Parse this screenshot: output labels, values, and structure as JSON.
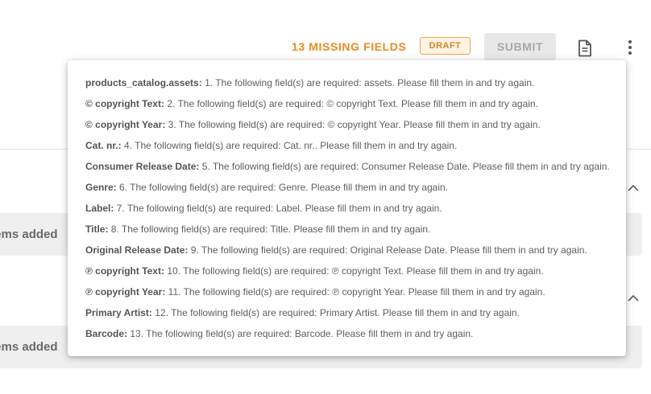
{
  "header": {
    "missing_fields_label": "13 MISSING FIELDS",
    "status_badge": "DRAFT",
    "submit_label": "SUBMIT",
    "doc_icon": "document-icon",
    "more_icon": "more-vertical-icon"
  },
  "sections": [
    {
      "label": "items added",
      "chevron": "chevron-up-icon"
    },
    {
      "label": "items added",
      "chevron": "chevron-up-icon"
    }
  ],
  "errors": [
    {
      "field": "products_catalog.assets:",
      "message": "1. The following field(s) are required: assets. Please fill them in and try again."
    },
    {
      "field": "© copyright Text:",
      "message": "2. The following field(s) are required: © copyright Text. Please fill them in and try again."
    },
    {
      "field": "© copyright Year:",
      "message": "3. The following field(s) are required: © copyright Year. Please fill them in and try again."
    },
    {
      "field": "Cat. nr.:",
      "message": "4. The following field(s) are required: Cat. nr.. Please fill them in and try again."
    },
    {
      "field": "Consumer Release Date:",
      "message": "5. The following field(s) are required: Consumer Release Date. Please fill them in and try again."
    },
    {
      "field": "Genre:",
      "message": "6. The following field(s) are required: Genre. Please fill them in and try again."
    },
    {
      "field": "Label:",
      "message": "7. The following field(s) are required: Label. Please fill them in and try again."
    },
    {
      "field": "Title:",
      "message": "8. The following field(s) are required: Title. Please fill them in and try again."
    },
    {
      "field": "Original Release Date:",
      "message": "9. The following field(s) are required: Original Release Date. Please fill them in and try again."
    },
    {
      "field": "℗ copyright Text:",
      "message": "10. The following field(s) are required: ℗ copyright Text. Please fill them in and try again."
    },
    {
      "field": "℗ copyright Year:",
      "message": "11. The following field(s) are required: ℗ copyright Year. Please fill them in and try again."
    },
    {
      "field": "Primary Artist:",
      "message": "12. The following field(s) are required: Primary Artist. Please fill them in and try again."
    },
    {
      "field": "Barcode:",
      "message": "13. The following field(s) are required: Barcode. Please fill them in and try again."
    }
  ],
  "colors": {
    "accent_orange": "#ec8a1c",
    "draft_border": "#e8a552",
    "draft_background": "#fff3e3",
    "submit_disabled_bg": "#e8e8e8",
    "submit_disabled_text": "#a9a9a9"
  }
}
